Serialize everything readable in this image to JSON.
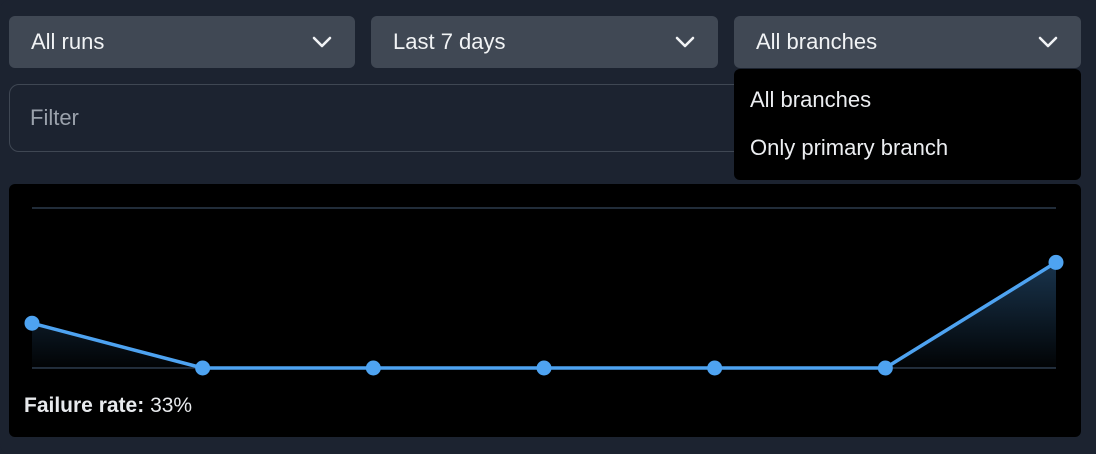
{
  "filters": {
    "runs": {
      "selected": "All runs"
    },
    "date_range": {
      "selected": "Last 7 days"
    },
    "branches": {
      "selected": "All branches",
      "open": true,
      "options": [
        "All branches",
        "Only primary branch"
      ]
    }
  },
  "search": {
    "placeholder": "Filter",
    "value": ""
  },
  "chart_data": {
    "type": "area",
    "x": [
      1,
      2,
      3,
      4,
      5,
      6,
      7
    ],
    "values": [
      0.14,
      0,
      0,
      0,
      0,
      0,
      0.33
    ],
    "ylim": [
      0,
      0.5
    ],
    "line_color": "#4ea3f1",
    "grid": true
  },
  "stat": {
    "label": "Failure rate:",
    "value": "33%"
  },
  "colors": {
    "background": "#1c2330",
    "select_bg": "#404854",
    "chart_bg": "#000000",
    "accent": "#4ea3f1"
  }
}
